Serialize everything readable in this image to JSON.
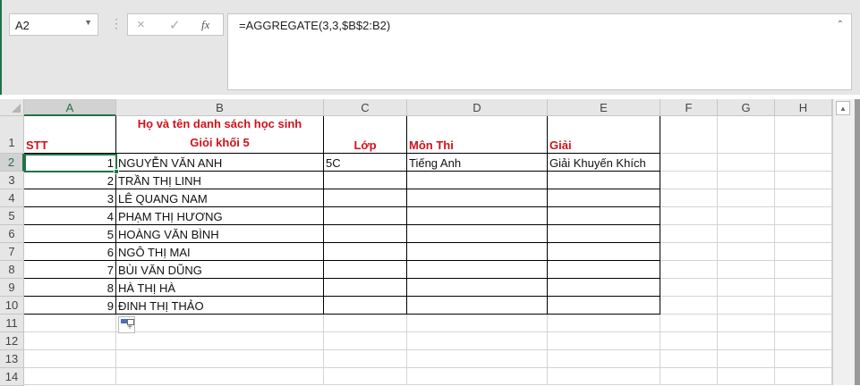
{
  "name_box": {
    "value": "A2"
  },
  "formula_bar": {
    "cancel_icon": "×",
    "enter_icon": "✓",
    "fx_label": "fx",
    "formula": "=AGGREGATE(3,3,$B$2:B2)"
  },
  "columns": [
    "A",
    "B",
    "C",
    "D",
    "E",
    "F",
    "G",
    "H"
  ],
  "rows": [
    "1",
    "2",
    "3",
    "4",
    "5",
    "6",
    "7",
    "8",
    "9",
    "10",
    "11",
    "12",
    "13",
    "14"
  ],
  "header": {
    "stt": "STT",
    "name_line1": "Họ và tên danh sách học sinh",
    "name_line2": "Giỏi khối 5",
    "class": "Lớp",
    "subject": "Môn Thi",
    "award": "Giải"
  },
  "students": [
    {
      "stt": "1",
      "name": "NGUYỄN VĂN ANH",
      "class": "5C",
      "subject": "Tiếng Anh",
      "award": "Giải Khuyến Khích"
    },
    {
      "stt": "2",
      "name": "TRẦN THỊ LINH",
      "class": "",
      "subject": "",
      "award": ""
    },
    {
      "stt": "3",
      "name": "LÊ QUANG NAM",
      "class": "",
      "subject": "",
      "award": ""
    },
    {
      "stt": "4",
      "name": "PHẠM THỊ HƯƠNG",
      "class": "",
      "subject": "",
      "award": ""
    },
    {
      "stt": "5",
      "name": "HOÀNG VĂN BÌNH",
      "class": "",
      "subject": "",
      "award": ""
    },
    {
      "stt": "6",
      "name": "NGÔ THỊ MAI",
      "class": "",
      "subject": "",
      "award": ""
    },
    {
      "stt": "7",
      "name": "BÙI VĂN DŨNG",
      "class": "",
      "subject": "",
      "award": ""
    },
    {
      "stt": "8",
      "name": "HÀ THỊ HÀ",
      "class": "",
      "subject": "",
      "award": ""
    },
    {
      "stt": "9",
      "name": "ĐINH THỊ THẢO",
      "class": "",
      "subject": "",
      "award": ""
    }
  ],
  "colors": {
    "accent": "#217346",
    "header_text": "#d0121b"
  }
}
